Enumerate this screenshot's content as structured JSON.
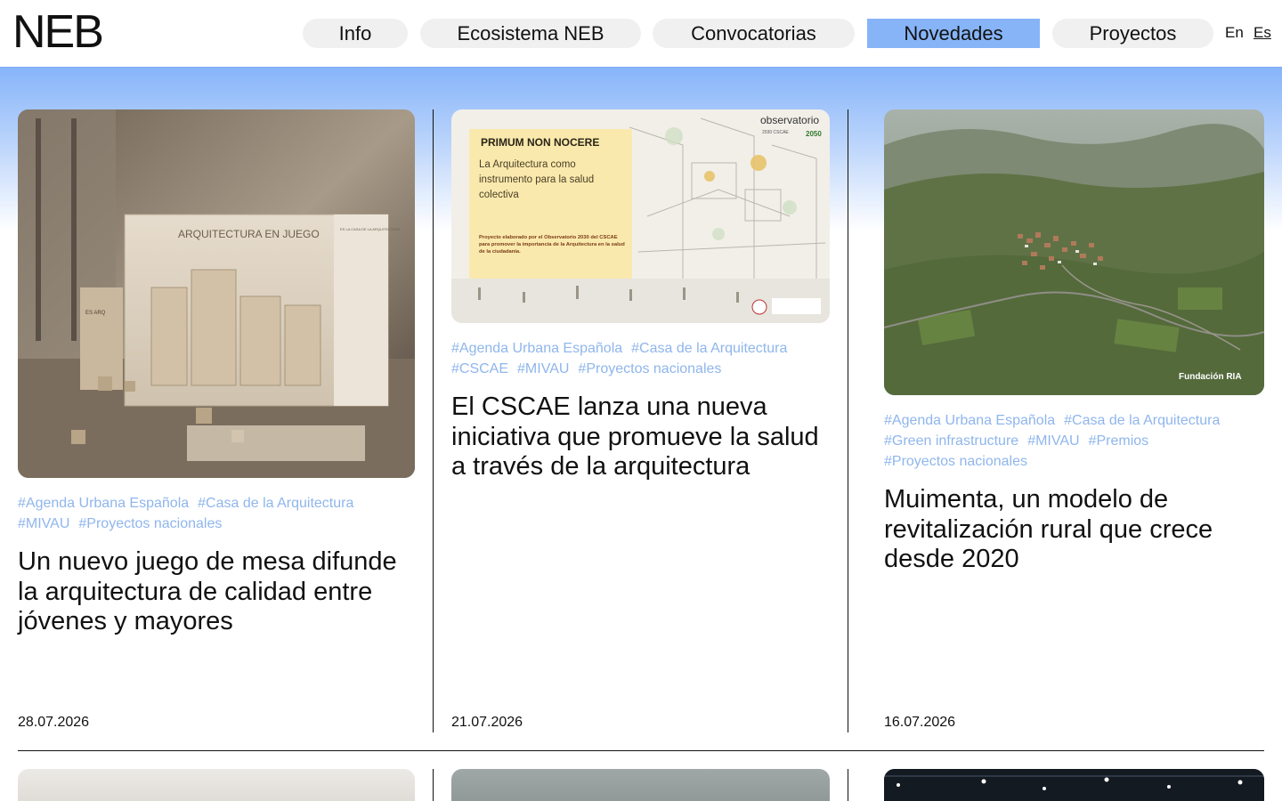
{
  "header": {
    "logo": "NEB",
    "nav": [
      {
        "label": "Info",
        "active": false
      },
      {
        "label": "Ecosistema NEB",
        "active": false
      },
      {
        "label": "Convocatorias",
        "active": false
      },
      {
        "label": "Novedades",
        "active": true
      },
      {
        "label": "Proyectos",
        "active": false
      }
    ],
    "languages": [
      {
        "label": "En",
        "active": false
      },
      {
        "label": "Es",
        "active": true
      }
    ]
  },
  "colors": {
    "accent": "#86b4f7",
    "tag": "#8fb6ec"
  },
  "cards": [
    {
      "image_text": {
        "box_title": "ARQUITECTURA EN JUEGO",
        "box_corner": "ES LA CASA DE LA ARQUITECTURA",
        "small_box": "ES ARQ"
      },
      "tags": [
        "#Agenda Urbana Española",
        "#Casa de la Arquitectura",
        "#MIVAU",
        "#Proyectos nacionales"
      ],
      "title": "Un nuevo juego de mesa difunde la arquitectura de calidad entre jóvenes y mayores",
      "date": "28.07.2026"
    },
    {
      "image_text": {
        "heading": "PRIMUM NON NOCERE",
        "subtitle": "La Arquitectura como instrumento para la salud colectiva",
        "note": "Proyecto elaborado por el Observatorio 2030 del CSCAE para promover la importancia de la Arquitectura en la salud de la ciudadanía.",
        "brand": "observatorio",
        "brand_sub": "2030 CSCAE",
        "brand_num": "2050"
      },
      "tags": [
        "#Agenda Urbana Española",
        "#Casa de la Arquitectura",
        "#CSCAE",
        "#MIVAU",
        "#Proyectos nacionales"
      ],
      "title": "El CSCAE lanza una nueva iniciativa que promueve la salud a través de la arquitectura",
      "date": "21.07.2026"
    },
    {
      "image_text": {
        "credit": "Fundación RIA"
      },
      "tags": [
        "#Agenda Urbana Española",
        "#Casa de la Arquitectura",
        "#Green infrastructure",
        "#MIVAU",
        "#Premios",
        "#Proyectos nacionales"
      ],
      "title": "Muimenta, un modelo de revitalización rural que crece desde 2020",
      "date": "16.07.2026"
    }
  ]
}
